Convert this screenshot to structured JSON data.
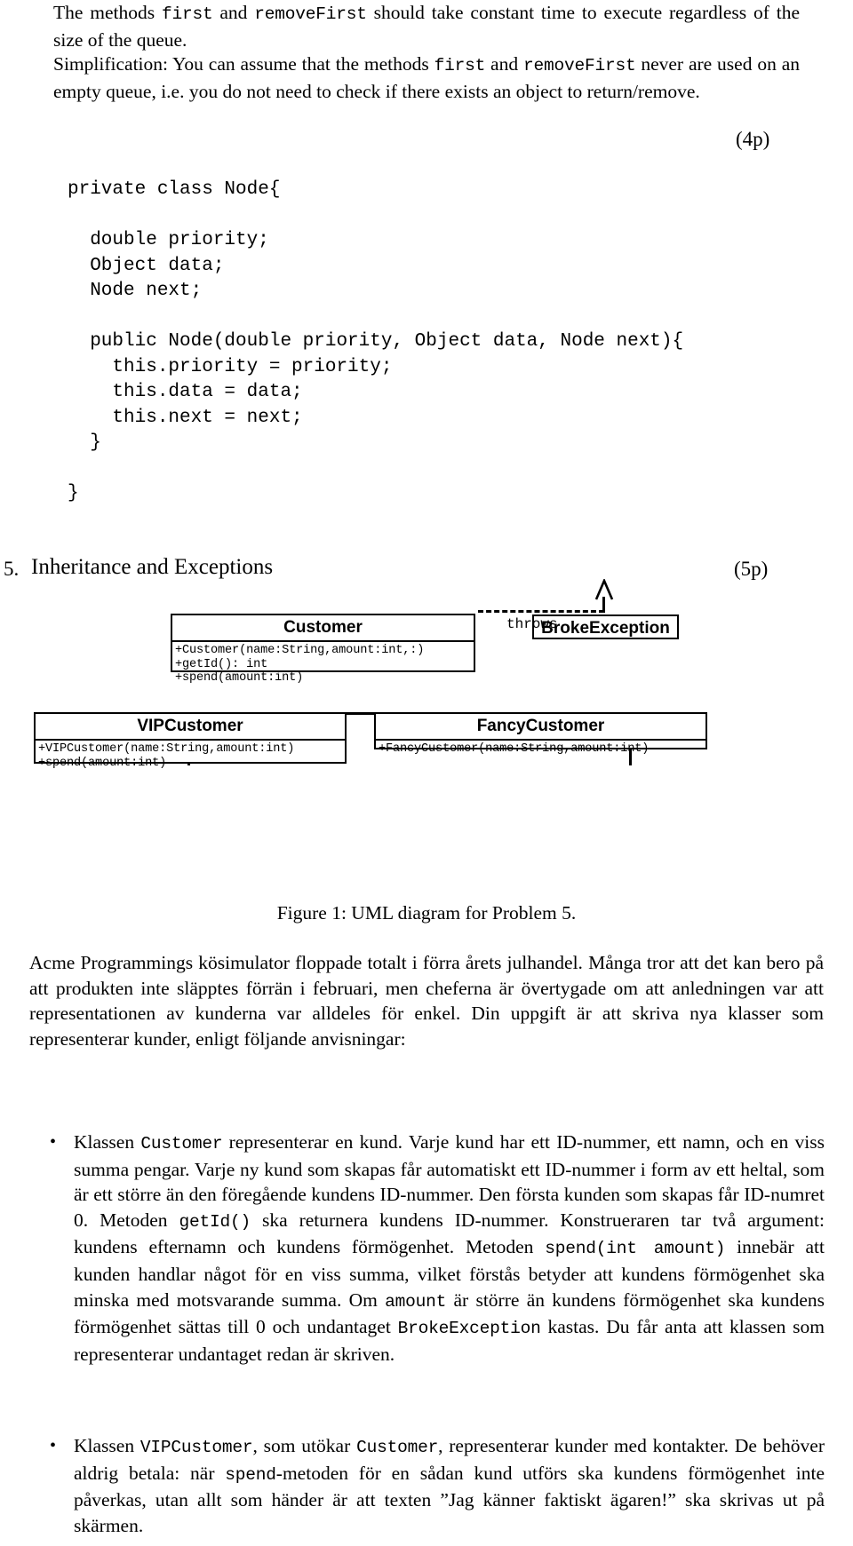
{
  "intro": {
    "p1_lines": [
      "The methods first and removeFirst should take constant time to execute",
      "regardless of the size of the queue."
    ],
    "p1_html": "The methods <span class=\"mono\">first</span> and <span class=\"mono\">removeFirst</span> should take constant time to execute regardless of the size of the queue.",
    "p2_html": "Simplification: You can assume that the methods <span class=\"mono\">first</span> and <span class=\"mono\">removeFirst</span> never are used on an empty queue, i.e. you do not need to check if there exists an object to return/remove.",
    "points": "(4p)"
  },
  "code": {
    "text": "private class Node{\n\n  double priority;\n  Object data;\n  Node next;\n\n  public Node(double priority, Object data, Node next){\n    this.priority = priority;\n    this.data = data;\n    this.next = next;\n  }\n\n}"
  },
  "problem5": {
    "number": "5.",
    "title": "Inheritance and Exceptions",
    "points": "(5p)"
  },
  "uml": {
    "classes": [
      {
        "id": "customer",
        "name": "Customer",
        "members": [
          "+Customer(name:String,amount:int,:)",
          "+getId(): int",
          "+spend(amount:int)"
        ]
      },
      {
        "id": "brokeexception",
        "name": "BrokeException",
        "members": []
      },
      {
        "id": "vipcustomer",
        "name": "VIPCustomer",
        "members": [
          "+VIPCustomer(name:String,amount:int)",
          "+spend(amount:int)"
        ]
      },
      {
        "id": "fancycustomer",
        "name": "FancyCustomer",
        "members": [
          "+FancyCustomer(name:String,amount:int)"
        ]
      }
    ],
    "throws_label": "throws"
  },
  "figure": {
    "caption": "Figure 1: UML diagram for Problem 5."
  },
  "body": {
    "p_intro_html": "Acme Programmings k&ouml;simulator floppade totalt i f&ouml;rra &aring;rets julhandel. M&aring;nga tror att det kan bero p&aring; att produkten inte sl&auml;pptes f&ouml;rr&auml;n i februari, men cheferna &auml;r &ouml;vertygade om att anledningen var att representationen av kunderna var alldeles f&ouml;r enkel. Din uppgift &auml;r att skriva nya klasser som representerar kunder, enligt f&ouml;ljande anvisningar:",
    "bullet1_html": "Klassen <span class=\"mono\">Customer</span> representerar en kund. Varje kund har ett ID-nummer, ett namn, och en viss summa pengar. Varje ny kund som skapas f&aring;r automatiskt ett ID-nummer i form av ett heltal, som &auml;r ett st&ouml;rre &auml;n den f&ouml;reg&aring;ende kundens ID-nummer. Den f&ouml;rsta kunden som skapas f&aring;r ID-numret 0. Metoden <span class=\"mono\">getId()</span> ska returnera kundens ID-nummer. Konstrueraren tar tv&aring; argument: kundens efternamn och kundens f&ouml;rm&ouml;genhet. Metoden <span class=\"mono\">spend(int amount)</span> inneb&auml;r att kunden handlar n&aring;got f&ouml;r en viss summa, vilket f&ouml;rst&aring;s betyder att kundens f&ouml;rm&ouml;genhet ska minska med motsvarande summa. Om <span class=\"mono\">amount</span> &auml;r st&ouml;rre &auml;n kundens f&ouml;rm&ouml;genhet ska kundens f&ouml;rm&ouml;genhet s&auml;ttas till 0 och undantaget <span class=\"mono\">BrokeException</span> kastas. Du f&aring;r anta att klassen som representerar undantaget redan &auml;r skriven.",
    "bullet2_html": "Klassen <span class=\"mono\">VIPCustomer</span>, som ut&ouml;kar <span class=\"mono\">Customer</span>, representerar kunder med kontakter. De beh&ouml;ver aldrig betala: n&auml;r <span class=\"mono\">spend</span>-metoden f&ouml;r en s&aring;dan kund utf&ouml;rs ska kundens f&ouml;rm&ouml;genhet inte p&aring;verkas, utan allt som h&auml;nder &auml;r att texten &rdquo;Jag k&auml;nner faktiskt &auml;garen!&rdquo; ska skrivas ut p&aring; sk&auml;rmen.",
    "bullet_marker": "•"
  }
}
